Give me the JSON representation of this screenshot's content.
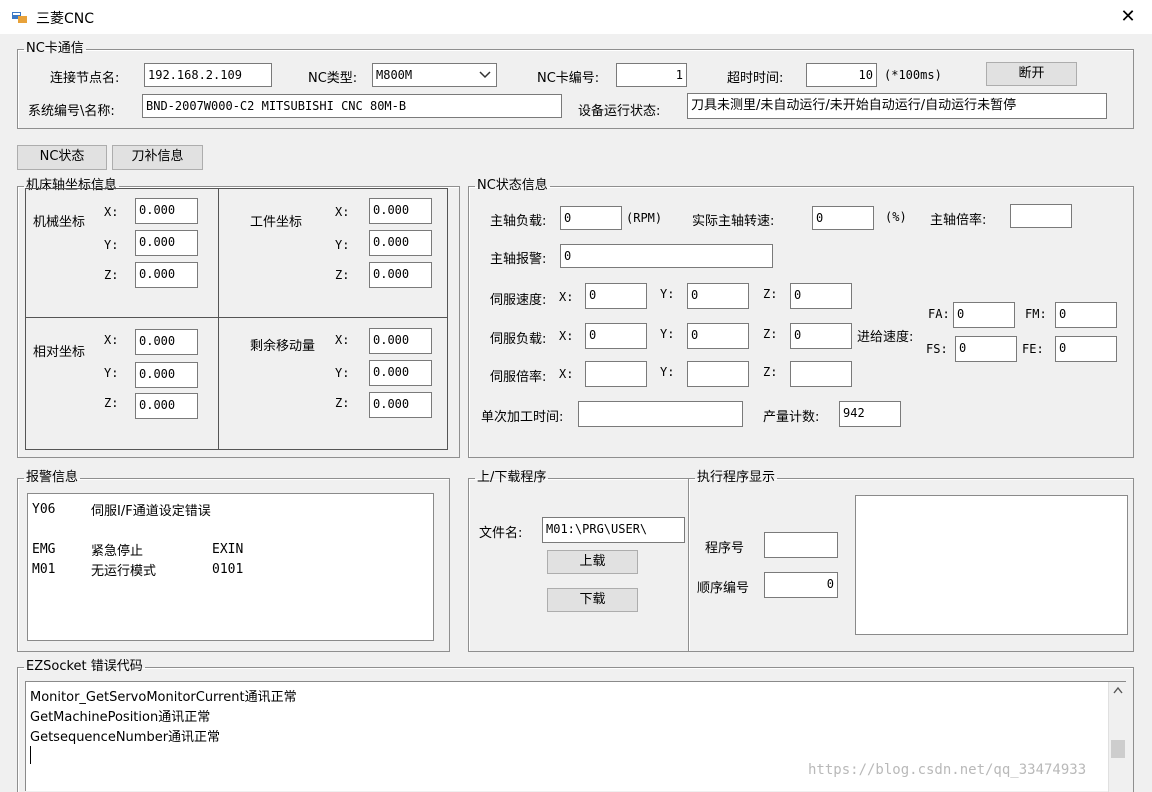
{
  "window": {
    "title": "三菱CNC",
    "close_symbol": "✕"
  },
  "nc_comm": {
    "legend": "NC卡通信",
    "node_name_label": "连接节点名:",
    "node_name_value": "192.168.2.109",
    "nc_type_label": "NC类型:",
    "nc_type_value": "M800M",
    "card_no_label": "NC卡编号:",
    "card_no_value": "1",
    "timeout_label": "超时时间:",
    "timeout_value": "10",
    "timeout_unit": "(*100ms)",
    "disconnect_label": "断开",
    "system_label": "系统编号\\名称:",
    "system_value": "BND-2007W000-C2 MITSUBISHI CNC 80M-B",
    "run_state_label": "设备运行状态:",
    "run_state_value": "刀具未测里/未自动运行/未开始自动运行/自动运行未暂停"
  },
  "tabs": {
    "nc_status": "NC状态",
    "tool_info": "刀补信息"
  },
  "axis": {
    "legend": "机床轴坐标信息",
    "machine_label": "机械坐标",
    "work_label": "工件坐标",
    "relative_label": "相对坐标",
    "remain_label": "剩余移动量",
    "x": "X:",
    "y": "Y:",
    "z": "Z:",
    "machine": [
      "0.000",
      "0.000",
      "0.000"
    ],
    "work": [
      "0.000",
      "0.000",
      "0.000"
    ],
    "relative": [
      "0.000",
      "0.000",
      "0.000"
    ],
    "remain": [
      "0.000",
      "0.000",
      "0.000"
    ]
  },
  "nc_status": {
    "legend": "NC状态信息",
    "spindle_load_label": "主轴负载:",
    "spindle_load_value": "0",
    "rpm_unit": "(RPM)",
    "actual_speed_label": "实际主轴转速:",
    "actual_speed_value": "0",
    "percent_unit": "(%)",
    "spindle_rate_label": "主轴倍率:",
    "spindle_rate_value": "",
    "spindle_alarm_label": "主轴报警:",
    "spindle_alarm_value": "0",
    "servo_speed_label": "伺服速度:",
    "servo_load_label": "伺服负载:",
    "servo_rate_label": "伺服倍率:",
    "x": "X:",
    "y": "Y:",
    "z": "Z:",
    "servo_speed": [
      "0",
      "0",
      "0"
    ],
    "servo_load": [
      "0",
      "0",
      "0"
    ],
    "servo_rate": [
      "",
      "",
      ""
    ],
    "feed_label": "进给速度:",
    "fa_label": "FA:",
    "fa_value": "0",
    "fm_label": "FM:",
    "fm_value": "0",
    "fs_label": "FS:",
    "fs_value": "0",
    "fe_label": "FE:",
    "fe_value": "0",
    "cycle_time_label": "单次加工时间:",
    "cycle_time_value": "",
    "count_label": "产量计数:",
    "count_value": "942"
  },
  "alarm": {
    "legend": "报警信息",
    "rows": [
      {
        "code": "Y06",
        "msg": "伺服I/F通道设定错误",
        "extra": ""
      },
      {
        "code": "EMG",
        "msg": "紧急停止",
        "extra": "EXIN"
      },
      {
        "code": "M01",
        "msg": "无运行模式",
        "extra": "0101"
      }
    ]
  },
  "transfer": {
    "legend": "上/下载程序",
    "file_label": "文件名:",
    "file_value": "M01:\\PRG\\USER\\",
    "upload_label": "上载",
    "download_label": "下载"
  },
  "exec": {
    "legend": "执行程序显示",
    "program_no_label": "程序号",
    "program_no_value": "",
    "seq_no_label": "顺序编号",
    "seq_no_value": "0"
  },
  "ezsocket": {
    "legend": "EZSocket 错误代码",
    "lines": [
      "Monitor_GetServoMonitorCurrent通讯正常",
      "GetMachinePosition通讯正常",
      "GetsequenceNumber通讯正常"
    ],
    "watermark": "https://blog.csdn.net/qq_33474933"
  }
}
